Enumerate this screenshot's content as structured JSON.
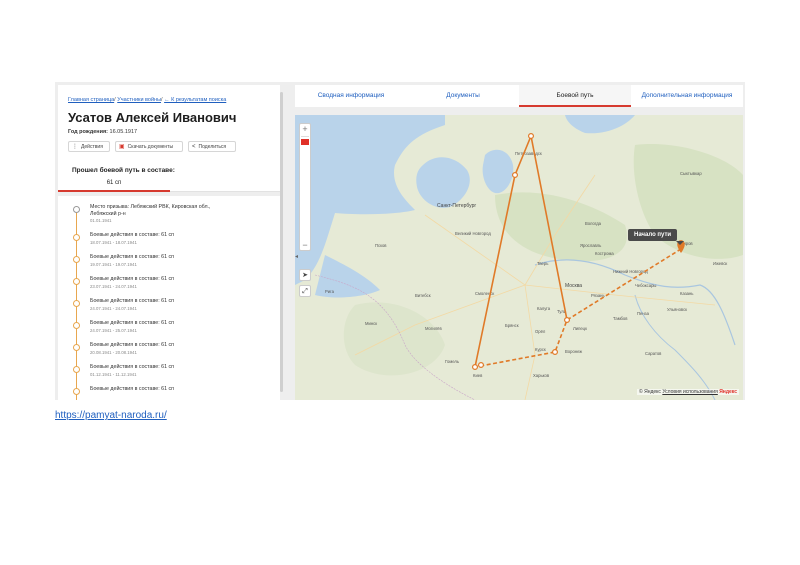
{
  "breadcrumb": {
    "home": "Главная страница",
    "sep1": "/",
    "participants": "Участники войны",
    "sep2": "/",
    "back": "← К результатам поиска"
  },
  "person": {
    "name": "Усатов Алексей Иванович",
    "birth_label": "Год рождения:",
    "birth_value": "16.05.1917"
  },
  "actions": {
    "actions_label": "Действия",
    "download_label": "Скачать документы",
    "share_label": "Поделиться"
  },
  "units": {
    "heading": "Прошел боевой путь в составе:",
    "tab": "61 сп"
  },
  "timeline": [
    {
      "text": "Место призыва: Лебяжский РВК, Кировская обл.,",
      "text2": "Лебяжский р-н",
      "date": "01.01.1941"
    },
    {
      "text": "Боевые действия в составе: 61 сп",
      "text2": "",
      "date": "18.07.1941 - 18.07.1941"
    },
    {
      "text": "Боевые действия в составе: 61 сп",
      "text2": "",
      "date": "19.07.1941 - 19.07.1941"
    },
    {
      "text": "Боевые действия в составе: 61 сп",
      "text2": "",
      "date": "23.07.1941 - 24.07.1941"
    },
    {
      "text": "Боевые действия в составе: 61 сп",
      "text2": "",
      "date": "24.07.1941 - 24.07.1941"
    },
    {
      "text": "Боевые действия в составе: 61 сп",
      "text2": "",
      "date": "24.07.1941 - 25.07.1941"
    },
    {
      "text": "Боевые действия в составе: 61 сп",
      "text2": "",
      "date": "20.08.1941 - 20.08.1941"
    },
    {
      "text": "Боевые действия в составе: 61 сп",
      "text2": "",
      "date": "01.12.1941 - 11.12.1941"
    },
    {
      "text": "Боевые действия в составе: 61 сп",
      "text2": "",
      "date": ""
    }
  ],
  "tabs": [
    "Сводная информация",
    "Документы",
    "Боевой путь",
    "Дополнительная информация"
  ],
  "map": {
    "start_tooltip": "Начало пути",
    "copyright_prefix": "© Яндекс",
    "terms_link": "Условия использования",
    "brand": "Яндекс",
    "route_color": "#e07a28",
    "cities": {
      "spb": "Санкт-Петербург",
      "moscow": "Москва",
      "petrozavodsk": "Петрозаводск",
      "kirov": "Киров",
      "kazan": "Казань",
      "voronezh": "Воронеж",
      "kharkov": "Харьков",
      "kiev": "Киев",
      "tver": "Тверь",
      "smolensk": "Смоленск",
      "vologda": "Вологда",
      "yaroslavl": "Ярославль",
      "nizhny": "Нижний Новгород",
      "tula": "Тула",
      "orel": "Орёл",
      "bryansk": "Брянск",
      "lipetsk": "Липецк",
      "tambov": "Тамбов",
      "penza": "Пенза",
      "ulyanovsk": "Ульяновск",
      "ryazan": "Рязань",
      "vitebsk": "Витебск",
      "gomel": "Гомель",
      "kursk": "Курск",
      "syktyvkar": "Сыктывкар",
      "izhevsk": "Ижевск",
      "pskov": "Псков",
      "novgorod": "Великий Новгород",
      "cheboksary": "Чебоксары",
      "kostroma": "Кострома",
      "kaluga": "Калуга",
      "mogilev": "Могилёв",
      "minsk": "Минск",
      "riga": "Рига",
      "saratov": "Саратов"
    }
  },
  "source_url": "https://pamyat-naroda.ru/"
}
